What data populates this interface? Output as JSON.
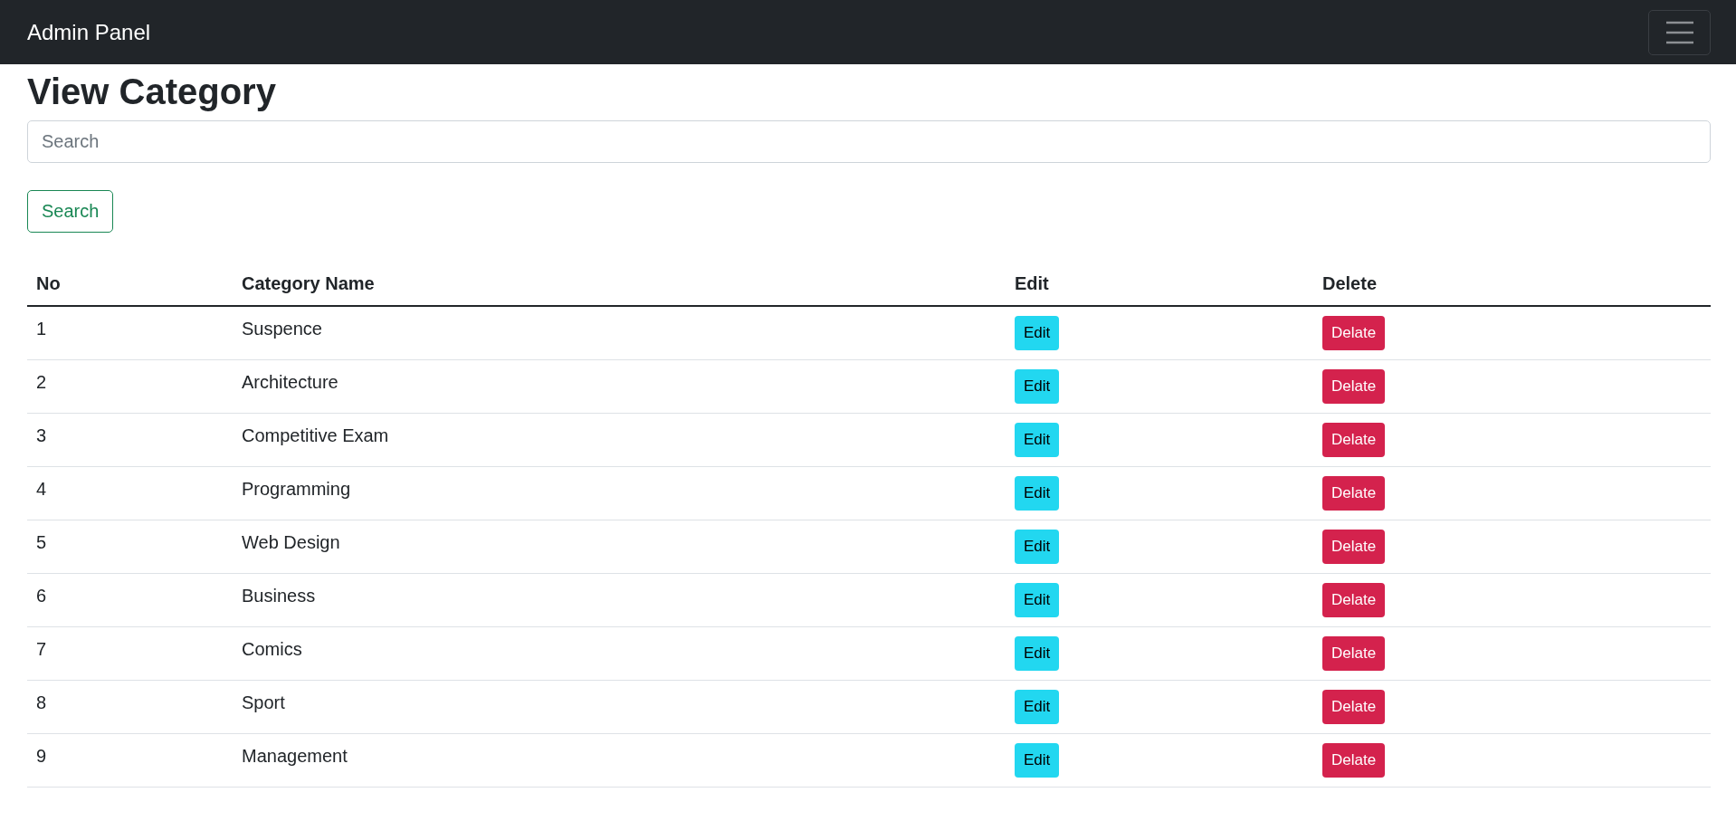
{
  "navbar": {
    "brand": "Admin Panel"
  },
  "heading": "View Category",
  "search": {
    "placeholder": "Search",
    "button": "Search"
  },
  "table": {
    "columns": [
      "No",
      "Category Name",
      "Edit",
      "Delete"
    ],
    "rows": [
      {
        "no": "1",
        "name": "Suspence",
        "edit": "Edit",
        "delete": "Delate"
      },
      {
        "no": "2",
        "name": "Architecture",
        "edit": "Edit",
        "delete": "Delate"
      },
      {
        "no": "3",
        "name": "Competitive Exam",
        "edit": "Edit",
        "delete": "Delate"
      },
      {
        "no": "4",
        "name": "Programming",
        "edit": "Edit",
        "delete": "Delate"
      },
      {
        "no": "5",
        "name": "Web Design",
        "edit": "Edit",
        "delete": "Delate"
      },
      {
        "no": "6",
        "name": "Business",
        "edit": "Edit",
        "delete": "Delate"
      },
      {
        "no": "7",
        "name": "Comics",
        "edit": "Edit",
        "delete": "Delate"
      },
      {
        "no": "8",
        "name": "Sport",
        "edit": "Edit",
        "delete": "Delate"
      },
      {
        "no": "9",
        "name": "Management",
        "edit": "Edit",
        "delete": "Delate"
      }
    ]
  }
}
